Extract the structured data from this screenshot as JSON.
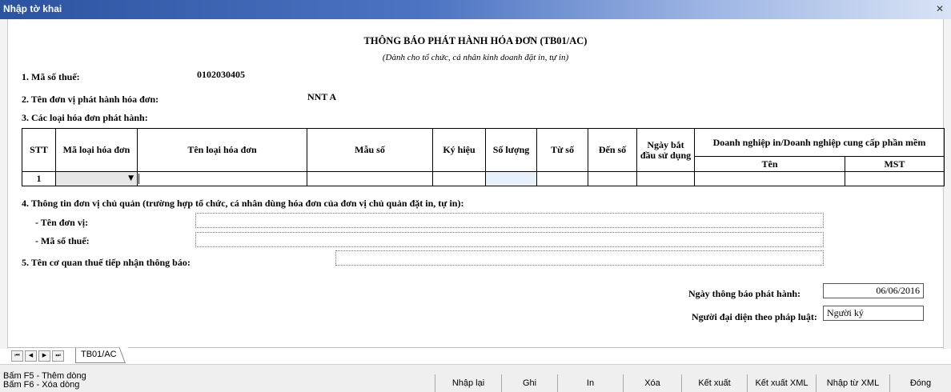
{
  "window": {
    "title": "Nhập tờ khai",
    "close_glyph": "✕"
  },
  "form": {
    "title": "THÔNG BÁO PHÁT HÀNH HÓA ĐƠN (TB01/AC)",
    "subtitle": "(Dành cho tổ chức, cá nhân kinh doanh đặt in, tự in)",
    "tax_code_label": "1. Mã số thuế:",
    "tax_code_value": "0102030405",
    "issuer_label": "2. Tên đơn vị phát hành hóa đơn:",
    "issuer_value": "NNT A",
    "invoice_types_label": "3. Các loại hóa đơn phát hành:",
    "section4_label": "4. Thông tin đơn vị chủ quản (trường hợp tổ chức, cá nhân dùng hóa đơn của đơn vị chủ quản đặt in, tự in):",
    "unit_name_label": "- Tên đơn vị:",
    "unit_tax_label": "- Mã số thuế:",
    "tax_office_label": "5. Tên cơ quan thuế tiếp nhận thông báo:",
    "notice_date_label": "Ngày thông báo phát hành:",
    "notice_date_value": "06/06/2016",
    "representative_label": "Người đại diện theo pháp luật:",
    "representative_value": "Người ký"
  },
  "table": {
    "headers": {
      "stt": "STT",
      "code": "Mã loại hóa đơn",
      "name": "Tên loại hóa đơn",
      "template": "Mẫu số",
      "symbol": "Ký hiệu",
      "quantity": "Số lượng",
      "from": "Từ số",
      "to": "Đến số",
      "start_date": "Ngày bắt đầu sử dụng",
      "printer_group": "Doanh nghiệp in/Doanh nghiệp cung cấp phần mềm",
      "printer_name": "Tên",
      "printer_tax": "MST"
    },
    "rows": [
      {
        "stt": "1"
      }
    ]
  },
  "tabs": {
    "sheet": "TB01/AC",
    "nav": [
      "⏮",
      "◀",
      "▶",
      "⏭"
    ]
  },
  "status": {
    "hint1": "Bấm F5 - Thêm dòng",
    "hint2": "Bấm F6 - Xóa dòng"
  },
  "buttons": [
    "Nhập lại",
    "Ghi",
    "In",
    "Xóa",
    "Kết xuất",
    "Kết xuất XML",
    "Nhập từ XML",
    "Đóng"
  ]
}
